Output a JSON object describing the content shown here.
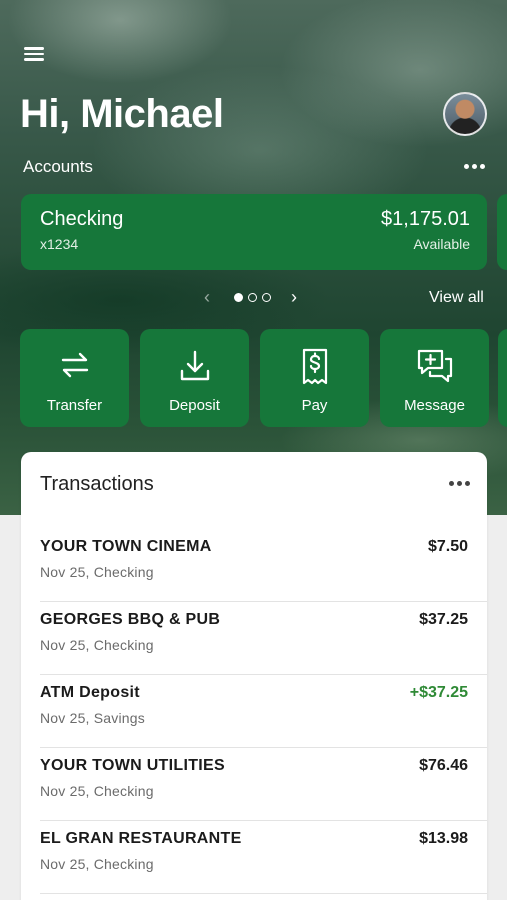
{
  "header": {
    "greeting": "Hi, Michael",
    "menu_icon": "hamburger-menu-icon",
    "avatar": "user-avatar"
  },
  "accounts": {
    "label": "Accounts",
    "more_icon": "more-dots-icon",
    "cards": [
      {
        "name": "Checking",
        "number": "x1234",
        "balance": "$1,175.01",
        "balance_label": "Available"
      }
    ],
    "pager": {
      "total": 3,
      "active": 0
    },
    "view_all": "View all"
  },
  "actions": [
    {
      "label": "Transfer",
      "icon": "transfer-arrows-icon"
    },
    {
      "label": "Deposit",
      "icon": "download-tray-icon"
    },
    {
      "label": "Pay",
      "icon": "bill-receipt-icon"
    },
    {
      "label": "Message",
      "icon": "chat-bubble-plus-icon"
    }
  ],
  "transactions": {
    "title": "Transactions",
    "items": [
      {
        "name": "YOUR TOWN CINEMA",
        "sub": "Nov 25, Checking",
        "amount": "$7.50",
        "positive": false
      },
      {
        "name": "GEORGES BBQ & PUB",
        "sub": "Nov 25, Checking",
        "amount": "$37.25",
        "positive": false
      },
      {
        "name": "ATM Deposit",
        "sub": "Nov 25, Savings",
        "amount": "+$37.25",
        "positive": true
      },
      {
        "name": "YOUR TOWN UTILITIES",
        "sub": "Nov 25, Checking",
        "amount": "$76.46",
        "positive": false
      },
      {
        "name": "EL GRAN RESTAURANTE",
        "sub": "Nov 25, Checking",
        "amount": "$13.98",
        "positive": false
      }
    ]
  },
  "colors": {
    "brand_green": "#16773a",
    "positive_green": "#2f8a36"
  }
}
